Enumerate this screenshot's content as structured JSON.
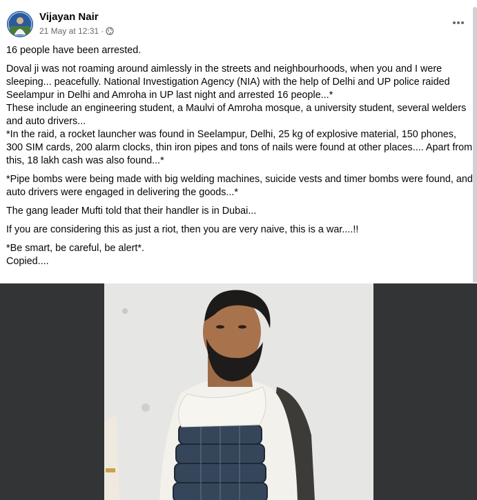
{
  "post": {
    "author": "Vijayan Nair",
    "timestamp": "21 May at 12:31 ·",
    "privacy_icon": "globe-icon",
    "menu_icon": "more-dots-icon",
    "paragraphs": [
      "16 people have been arrested.",
      "Doval ji was not roaming around aimlessly in the streets and neighbourhoods, when you and I were sleeping... peacefully. National Investigation Agency (NIA) with the help of Delhi and UP police raided Seelampur in Delhi and Amroha in UP last night and arrested 16 people...*",
      "These include an engineering student, a Maulvi of Amroha mosque, a university student, several welders and auto drivers...",
      "*In the raid, a rocket launcher was found in Seelampur, Delhi, 25 kg of explosive material, 150 phones, 300 SIM cards, 200 alarm clocks, thin iron pipes and tons of nails were found at other places.... Apart from this, 18 lakh cash was also found...*",
      "*Pipe bombs were being made with big welding machines, suicide vests and timer bombs were found, and auto drivers were engaged in delivering the goods...*",
      "The gang leader Mufti told that their handler is in Dubai...",
      "If you are considering this as just a riot, then you are very naive, this is a war....!!",
      "*Be smart, be careful, be alert*.",
      "Copied...."
    ]
  },
  "colors": {
    "text": "#050505",
    "meta": "#65676b",
    "photo_backdrop": "#333436"
  }
}
